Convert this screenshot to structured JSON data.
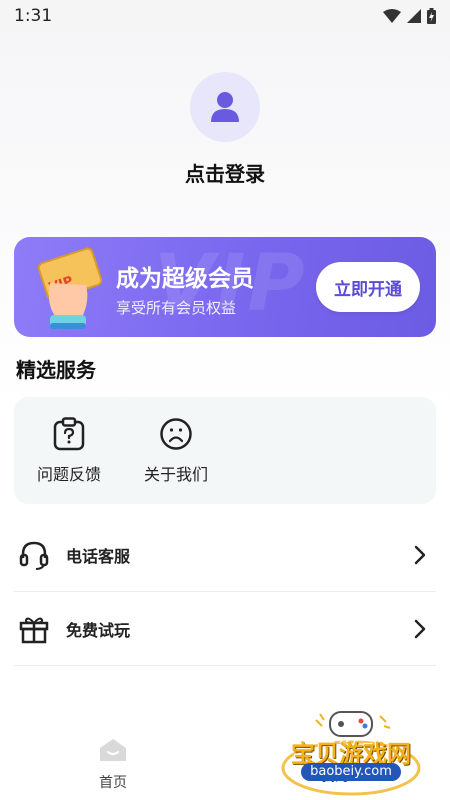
{
  "status_bar": {
    "time": "1:31"
  },
  "profile": {
    "login_label": "点击登录"
  },
  "vip": {
    "watermark": "VIP",
    "card_badge": "VIP",
    "title": "成为超级会员",
    "subtitle": "享受所有会员权益",
    "button_label": "立即开通",
    "colors": {
      "start": "#8e7cf8",
      "end": "#6c5ce3"
    }
  },
  "services": {
    "title": "精选服务",
    "items": [
      {
        "label": "问题反馈",
        "icon": "feedback-icon"
      },
      {
        "label": "关于我们",
        "icon": "about-icon"
      }
    ]
  },
  "list": {
    "items": [
      {
        "label": "电话客服",
        "icon": "headset-icon"
      },
      {
        "label": "免费试玩",
        "icon": "gift-icon"
      }
    ]
  },
  "bottom_nav": {
    "items": [
      {
        "label": "首页",
        "icon": "home-icon"
      },
      {
        "label": "我的",
        "icon": "user-icon"
      }
    ]
  },
  "watermark_logo": {
    "text": "宝贝游戏网",
    "url": "baobeiy.com"
  }
}
